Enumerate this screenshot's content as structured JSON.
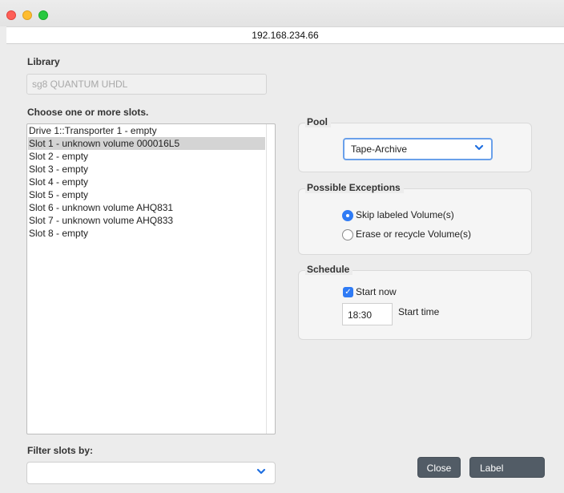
{
  "window": {
    "address": "192.168.234.66"
  },
  "library": {
    "label": "Library",
    "value": "sg8 QUANTUM UHDL"
  },
  "slots": {
    "label": "Choose one or more slots.",
    "items": [
      "Drive 1::Transporter 1 - empty",
      "Slot 1 - unknown volume 000016L5",
      "Slot 2 - empty",
      "Slot 3 - empty",
      "Slot 4 - empty",
      "Slot 5 - empty",
      "Slot 6 - unknown volume AHQ831",
      "Slot 7 - unknown volume AHQ833",
      "Slot 8 - empty"
    ],
    "selected_index": 1
  },
  "filter": {
    "label": "Filter slots by:",
    "value": ""
  },
  "pool": {
    "title": "Pool",
    "selected": "Tape-Archive"
  },
  "exceptions": {
    "title": "Possible Exceptions",
    "options": [
      "Skip labeled Volume(s)",
      "Erase or recycle Volume(s)"
    ],
    "selected_index": 0
  },
  "schedule": {
    "title": "Schedule",
    "start_now_label": "Start now",
    "start_now_checked": true,
    "time_value": "18:30",
    "start_time_label": "Start time"
  },
  "buttons": {
    "close": "Close",
    "label": "Label"
  },
  "colors": {
    "accent": "#2f7bf5",
    "button": "#525c66",
    "selection": "#d4d4d4"
  }
}
